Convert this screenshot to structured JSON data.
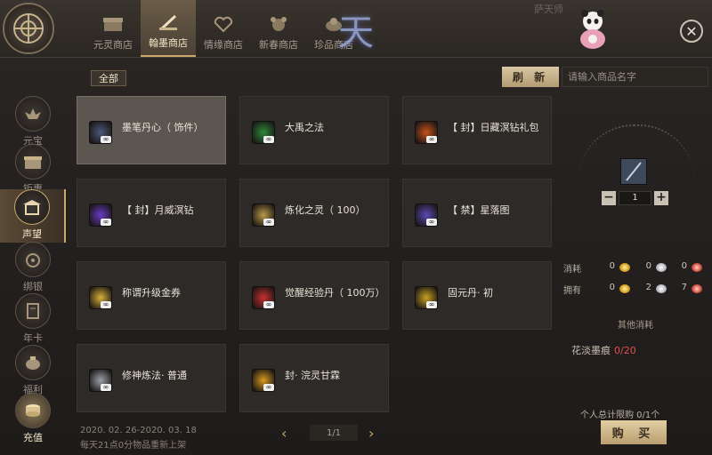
{
  "window": {
    "close_icon": "close-icon",
    "watermark": "萨天师"
  },
  "tabs": [
    {
      "label": "元灵商店",
      "icon": "chest-icon",
      "active": false
    },
    {
      "label": "翰墨商店",
      "icon": "brush-icon",
      "active": true
    },
    {
      "label": "情缘商店",
      "icon": "heart-icon",
      "active": false
    },
    {
      "label": "新春商店",
      "icon": "mouse-icon",
      "active": false
    },
    {
      "label": "珍品商店",
      "icon": "treasure-icon",
      "active": false
    }
  ],
  "title_art": "天",
  "sidebar": {
    "items": [
      {
        "label": "元宝",
        "icon": "ingot-icon"
      },
      {
        "label": "钜惠",
        "icon": "gift-box-icon"
      },
      {
        "label": "声望",
        "icon": "pavilion-icon",
        "active": true
      },
      {
        "label": "绑银",
        "icon": "coin-pouch-icon"
      },
      {
        "label": "年卡",
        "icon": "card-icon"
      },
      {
        "label": "福利",
        "icon": "bag-icon"
      },
      {
        "label": "充值",
        "icon": "coin-stack-icon"
      }
    ]
  },
  "filter": {
    "all_label": "全部"
  },
  "refresh_label": "刷 新",
  "search": {
    "placeholder": "请输入商品名字",
    "value": ""
  },
  "items": [
    {
      "name": "墨笔丹心（ 饰件）",
      "icon_color": "#4a5a7a",
      "selected": true
    },
    {
      "name": "大禹之法",
      "icon_color": "#2e8a3a"
    },
    {
      "name": "【 封】日藏溟钻礼包",
      "icon_color": "#c8501a"
    },
    {
      "name": "【 封】月威溟钻",
      "icon_color": "#6a3ac8"
    },
    {
      "name": "炼化之灵（ 100）",
      "icon_color": "#b89a4a"
    },
    {
      "name": "【 禁】星落图",
      "icon_color": "#5a4ab8"
    },
    {
      "name": "称谓升级金券",
      "icon_color": "#d8b03a"
    },
    {
      "name": "觉醒经验丹（ 100万）",
      "icon_color": "#c83030"
    },
    {
      "name": "固元丹· 初",
      "icon_color": "#c8a020"
    },
    {
      "name": "修神炼法· 普通",
      "icon_color": "#9aa0a8"
    },
    {
      "name": "封· 浣灵甘霖",
      "icon_color": "#d89a20"
    }
  ],
  "pager": {
    "prev_icon": "chevron-left-icon",
    "next_icon": "chevron-right-icon",
    "page": "1/1"
  },
  "dates": {
    "range": "2020. 02. 26-2020. 03. 18",
    "note": "每天21点0分物品重新上架"
  },
  "detail": {
    "quantity": "1",
    "minus": "−",
    "plus": "+",
    "consume_label": "消耗",
    "own_label": "拥有",
    "consume": [
      "0",
      "0",
      "0"
    ],
    "own": [
      "0",
      "2",
      "7"
    ],
    "other_title": "其他消耗",
    "other_item_name": "花淡墨痕",
    "other_item_count": "0/20",
    "limit": "个人总计限购 0/1个",
    "buy_label": "购 买"
  }
}
